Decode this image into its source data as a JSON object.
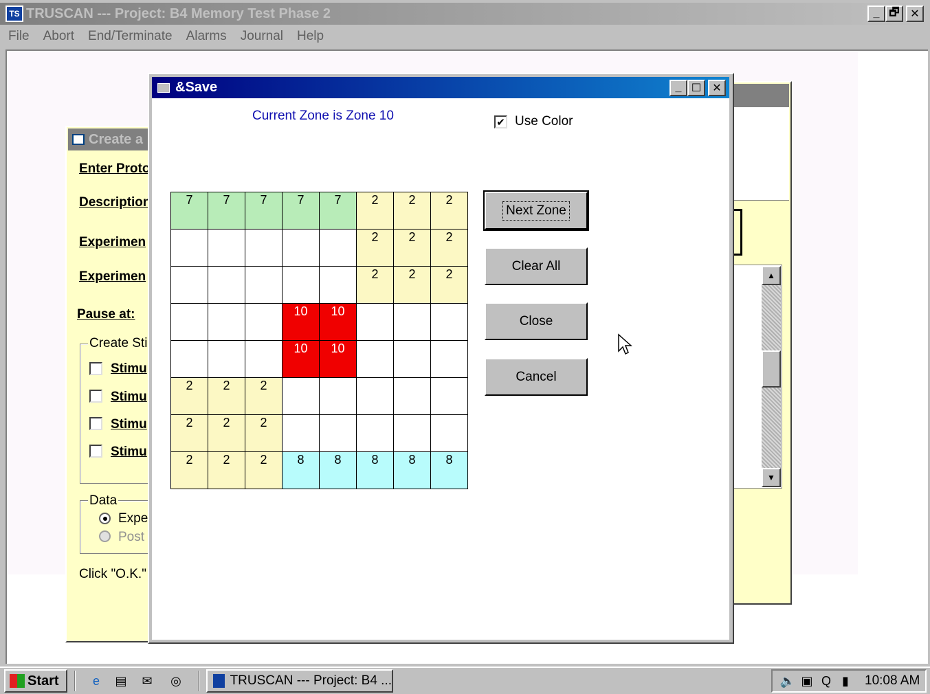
{
  "main_window": {
    "title": "TRUSCAN --- Project: B4  Memory Test Phase 2",
    "icon": "truscan-app-icon",
    "controls": {
      "minimize": "_",
      "maximize": "🗗",
      "close": "✕"
    }
  },
  "menu": {
    "items": [
      {
        "label": "File",
        "accel": "F"
      },
      {
        "label": "Abort",
        "accel": "A"
      },
      {
        "label": "End/Terminate",
        "accel": "T"
      },
      {
        "label": "Alarms",
        "accel": "l"
      },
      {
        "label": "Journal",
        "accel": "J"
      },
      {
        "label": "Help",
        "accel": "H"
      }
    ]
  },
  "create_dialog": {
    "title": "Create a",
    "labels": [
      "Enter Proto",
      "Description",
      "Experimen",
      "Experimen"
    ],
    "pause_label": "Pause at:",
    "group_stimuli": "Create Stir",
    "stimuli": [
      "Stimu",
      "Stimu",
      "Stimu",
      "Stimu"
    ],
    "group_data": "Data",
    "radio": [
      {
        "label": "Expe",
        "checked": true
      },
      {
        "label": "Post",
        "checked": false
      }
    ],
    "footer_text": "Click \"O.K.\""
  },
  "save_dialog": {
    "title": "&Save",
    "zone_status": "Current Zone is Zone 10",
    "use_color_label": "Use Color",
    "use_color_checked": true,
    "buttons": {
      "next_zone": "Next Zone",
      "clear_all": "Clear All",
      "close": "Close",
      "cancel": "Cancel"
    },
    "grid": [
      [
        "7",
        "7",
        "7",
        "7",
        "7",
        "2",
        "2",
        "2"
      ],
      [
        "",
        "",
        "",
        "",
        "",
        "2",
        "2",
        "2"
      ],
      [
        "",
        "",
        "",
        "",
        "",
        "2",
        "2",
        "2"
      ],
      [
        "",
        "",
        "",
        "10",
        "10",
        "",
        "",
        ""
      ],
      [
        "",
        "",
        "",
        "10",
        "10",
        "",
        "",
        ""
      ],
      [
        "2",
        "2",
        "2",
        "",
        "",
        "",
        "",
        ""
      ],
      [
        "2",
        "2",
        "2",
        "",
        "",
        "",
        "",
        ""
      ],
      [
        "2",
        "2",
        "2",
        "8",
        "8",
        "8",
        "8",
        "8"
      ]
    ],
    "zone_colors": {
      "7": "#b8ecb8",
      "2": "#fcf8c4",
      "10": "#f00000",
      "8": "#b8fcfc"
    }
  },
  "taskbar": {
    "start_label": "Start",
    "task_label": "TRUSCAN --- Project: B4  ...",
    "clock": "10:08 AM"
  }
}
